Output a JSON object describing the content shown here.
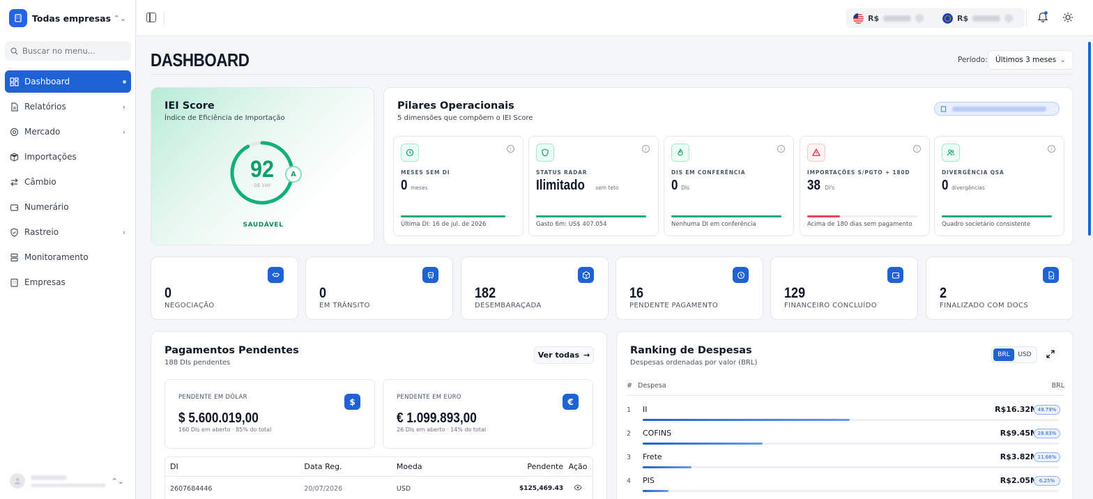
{
  "sidebar": {
    "company": "Todas empresas",
    "search_placeholder": "Buscar no menu...",
    "items": [
      {
        "label": "Dashboard"
      },
      {
        "label": "Relatórios"
      },
      {
        "label": "Mercado"
      },
      {
        "label": "Importações"
      },
      {
        "label": "Câmbio"
      },
      {
        "label": "Numerário"
      },
      {
        "label": "Rastreio"
      },
      {
        "label": "Monitoramento"
      },
      {
        "label": "Empresas"
      }
    ]
  },
  "topbar": {
    "usd_label": "R$",
    "eur_label": "R$"
  },
  "page": {
    "title": "DASHBOARD",
    "period_label": "Período:",
    "period_value": "Últimos 3 meses"
  },
  "iei": {
    "title": "IEI Score",
    "subtitle": "Índice de Eficiência de Importação",
    "score": "92",
    "score_sub": "DE 100",
    "score_fraction": 0.92,
    "grade": "A",
    "status": "SAUDÁVEL"
  },
  "pilares": {
    "title": "Pilares Operacionais",
    "subtitle": "5 dimensões que compõem o IEI Score",
    "items": [
      {
        "label": "MESES SEM DI",
        "value": "0",
        "unit": "meses",
        "footer": "Última DI: 16 de jul. de 2026",
        "progress": 0.95,
        "color": "#10b07a",
        "icon": "clock-icon"
      },
      {
        "label": "STATUS RADAR",
        "value": "Ilimitado",
        "unit": "sem teto",
        "footer": "Gasto 6m: US$ 407.054",
        "progress": 1.0,
        "color": "#10b07a",
        "icon": "shield-icon"
      },
      {
        "label": "DIS EM CONFERÊNCIA",
        "value": "0",
        "unit": "DIs",
        "footer": "Nenhuma DI em conferência",
        "progress": 1.0,
        "color": "#10b07a",
        "icon": "flame-icon"
      },
      {
        "label": "IMPORTAÇÕES S/PGTO + 180D",
        "value": "38",
        "unit": "DI's",
        "footer": "Acima de 180 dias sem pagamento",
        "progress": 0.3,
        "color": "#f43f5e",
        "icon": "alert-icon"
      },
      {
        "label": "DIVERGÊNCIA QSA",
        "value": "0",
        "unit": "divergências",
        "footer": "Quadro societário consistente",
        "progress": 1.0,
        "color": "#10b07a",
        "icon": "users-icon"
      }
    ]
  },
  "stats": [
    {
      "value": "0",
      "label": "NEGOCIAÇÃO",
      "icon": "handshake-icon"
    },
    {
      "value": "0",
      "label": "EM TRÂNSITO",
      "icon": "truck-icon"
    },
    {
      "value": "182",
      "label": "DESEMBARAÇADA",
      "icon": "package-icon"
    },
    {
      "value": "16",
      "label": "PENDENTE PAGAMENTO",
      "icon": "clock-icon"
    },
    {
      "value": "129",
      "label": "FINANCEIRO CONCLUÍDO",
      "icon": "wallet-icon"
    },
    {
      "value": "2",
      "label": "FINALIZADO COM DOCS",
      "icon": "document-icon"
    }
  ],
  "pagamentos": {
    "title": "Pagamentos Pendentes",
    "subtitle": "188 DIs pendentes",
    "ver_todas": "Ver todas",
    "usd": {
      "label": "PENDENTE EM DÓLAR",
      "value": "$ 5.600.019,00",
      "sub": "160 DIs em aberto · 85% do total",
      "symbol": "$"
    },
    "eur": {
      "label": "PENDENTE EM EURO",
      "value": "€ 1.099.893,00",
      "sub": "26 DIs em aberto · 14% do total",
      "symbol": "€"
    },
    "columns": [
      "DI",
      "Data Reg.",
      "Moeda",
      "Pendente",
      "Ação"
    ],
    "rows": [
      {
        "di": "2607684446",
        "date": "20/07/2026",
        "currency": "USD",
        "pending": "$125,469.43"
      }
    ]
  },
  "ranking": {
    "title": "Ranking de Despesas",
    "subtitle": "Despesas ordenadas por valor (BRL)",
    "toggle": [
      "BRL",
      "USD"
    ],
    "col_num": "#",
    "col_name": "Despesa",
    "col_currency": "BRL",
    "rows": [
      {
        "rank": "1",
        "name": "II",
        "amount": "R$16.32M",
        "pct": "49.79%",
        "share": 0.4979
      },
      {
        "rank": "2",
        "name": "COFINS",
        "amount": "R$9.45M",
        "pct": "28.83%",
        "share": 0.2883
      },
      {
        "rank": "3",
        "name": "Frete",
        "amount": "R$3.82M",
        "pct": "11.66%",
        "share": 0.1166
      },
      {
        "rank": "4",
        "name": "PIS",
        "amount": "R$2.05M",
        "pct": "6.25%",
        "share": 0.0625
      }
    ]
  }
}
